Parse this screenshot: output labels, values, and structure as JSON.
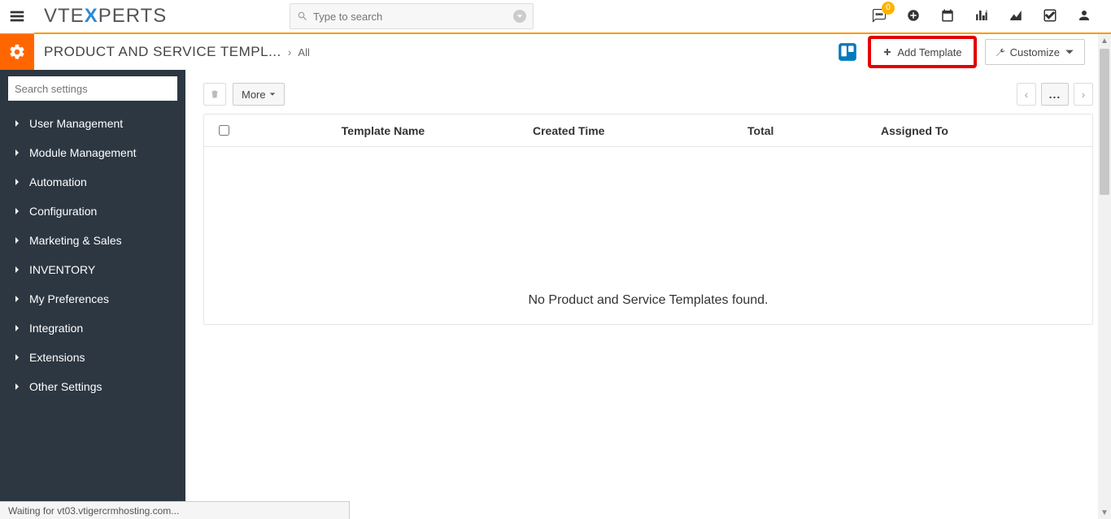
{
  "header": {
    "logo_prefix": "VTE",
    "logo_x": "X",
    "logo_suffix": "PERTS",
    "search_placeholder": "Type to search",
    "notification_count": "0"
  },
  "breadcrumb": {
    "main": "PRODUCT AND SERVICE TEMPL...",
    "sub": "All"
  },
  "actions": {
    "add_template": "Add Template",
    "customize": "Customize"
  },
  "sidebar": {
    "search_placeholder": "Search settings",
    "items": [
      {
        "label": "User Management"
      },
      {
        "label": "Module Management"
      },
      {
        "label": "Automation"
      },
      {
        "label": "Configuration"
      },
      {
        "label": "Marketing & Sales"
      },
      {
        "label": "INVENTORY"
      },
      {
        "label": "My Preferences"
      },
      {
        "label": "Integration"
      },
      {
        "label": "Extensions"
      },
      {
        "label": "Other Settings"
      }
    ]
  },
  "toolbar": {
    "more": "More"
  },
  "table": {
    "columns": {
      "template_name": "Template Name",
      "created_time": "Created Time",
      "total": "Total",
      "assigned_to": "Assigned To"
    },
    "empty_message": "No Product and Service Templates found."
  },
  "status": {
    "text": "Waiting for vt03.vtigercrmhosting.com..."
  },
  "pager": {
    "dots": "..."
  }
}
